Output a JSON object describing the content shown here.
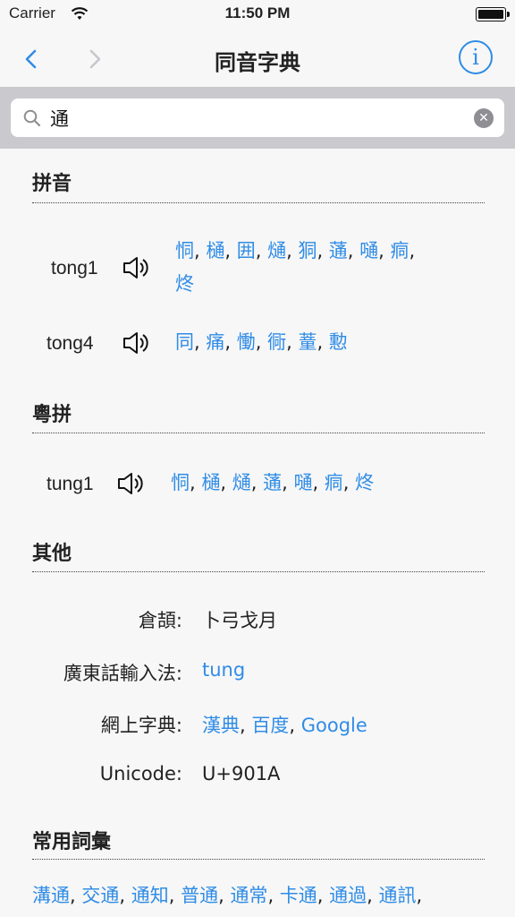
{
  "status": {
    "carrier": "Carrier",
    "time": "11:50 PM"
  },
  "nav": {
    "title": "同音字典",
    "info_glyph": "i"
  },
  "search": {
    "value": "通"
  },
  "sections": {
    "pinyin": {
      "title": "拼音",
      "rows": [
        {
          "label": "tong1",
          "chars": [
            "恫",
            "樋",
            "囲",
            "熥",
            "狪",
            "蓪",
            "嗵",
            "痌",
            "炵"
          ]
        },
        {
          "label": "tong4",
          "chars": [
            "同",
            "痛",
            "慟",
            "衕",
            "蕫",
            "憅"
          ]
        }
      ]
    },
    "jyutping": {
      "title": "粵拼",
      "rows": [
        {
          "label": "tung1",
          "chars": [
            "恫",
            "樋",
            "熥",
            "蓪",
            "嗵",
            "痌",
            "炵"
          ]
        }
      ]
    },
    "other": {
      "title": "其他",
      "cangjie_label": "倉頡:",
      "cangjie_value": "卜弓戈月",
      "cantonese_label": "廣東話輸入法:",
      "cantonese_value": "tung",
      "online_label": "網上字典:",
      "online_links": [
        "漢典",
        "百度",
        "Google"
      ],
      "unicode_label": "Unicode:",
      "unicode_value": "U+901A"
    },
    "words": {
      "title": "常用詞彙",
      "items": [
        "溝通",
        "交通",
        "通知",
        "普通",
        "通常",
        "卡通",
        "通過",
        "通訊"
      ]
    }
  },
  "icons": {
    "back": "chevron-left-icon",
    "forward": "chevron-right-icon",
    "info": "info-icon",
    "search": "magnifier-icon",
    "clear": "clear-icon",
    "speaker": "speaker-icon"
  },
  "colors": {
    "accent": "#2f8ce6",
    "search_bg": "#c9c9ce"
  }
}
